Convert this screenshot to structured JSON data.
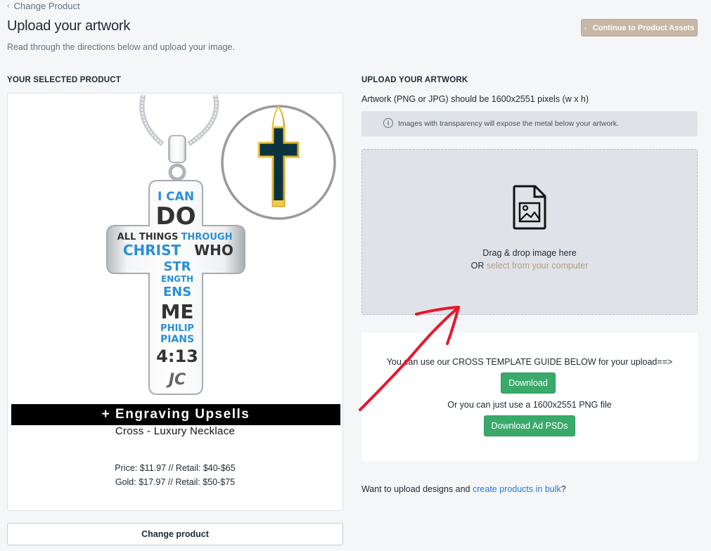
{
  "header": {
    "breadcrumb": "Change Product",
    "title": "Upload your artwork",
    "subtitle": "Read through the directions below and upload your image.",
    "continue_label": "Continue to Product Assets"
  },
  "product": {
    "heading": "YOUR SELECTED PRODUCT",
    "banner": "+ Engraving Upsells",
    "name": "Cross - Luxury Necklace",
    "price": "Price: $11.97 // Retail: $40-$65",
    "gold": "Gold: $17.97 // Retail: $50-$75",
    "change_label": "Change product",
    "engraving_lines": {
      "line1": "I CAN",
      "line2": "DO",
      "line3a": "ALL THINGS",
      "line3b": "THROUGH",
      "line4a": "CHRIST",
      "line4b": "WHO",
      "line5": "STR",
      "line6": "ENGTH",
      "line7": "ENS",
      "line8": "ME",
      "line9": "PHILIP",
      "line10": "PIANS",
      "line11": "4:13",
      "line12": "JC"
    }
  },
  "upload": {
    "heading": "UPLOAD YOUR ARTWORK",
    "spec": "Artwork (PNG or JPG) should be 1600x2551 pixels (w x h)",
    "info": "Images with transparency will expose the metal below your artwork.",
    "drop_text": "Drag & drop image here",
    "or_prefix": "OR",
    "select_link": "select from your computer"
  },
  "template": {
    "guide_text": "You can use our CROSS TEMPLATE GUIDE BELOW for your upload==>",
    "download_label": "Download",
    "or_text": "Or you can just use a 1600x2551 PNG file",
    "psd_label": "Download Ad PSDs"
  },
  "bulk": {
    "prefix": "Want to upload designs and",
    "link": "create products in bulk",
    "suffix": "?"
  },
  "colors": {
    "accent_tan": "#c8b6a6",
    "link_tan": "#b49c7f",
    "green": "#3aaa6a",
    "link_blue": "#1c7ed6",
    "annotation_red": "#e8162c"
  },
  "icons": {
    "file_image": "file-image-icon",
    "info": "info-icon",
    "chevron": "chevron-left-icon"
  }
}
